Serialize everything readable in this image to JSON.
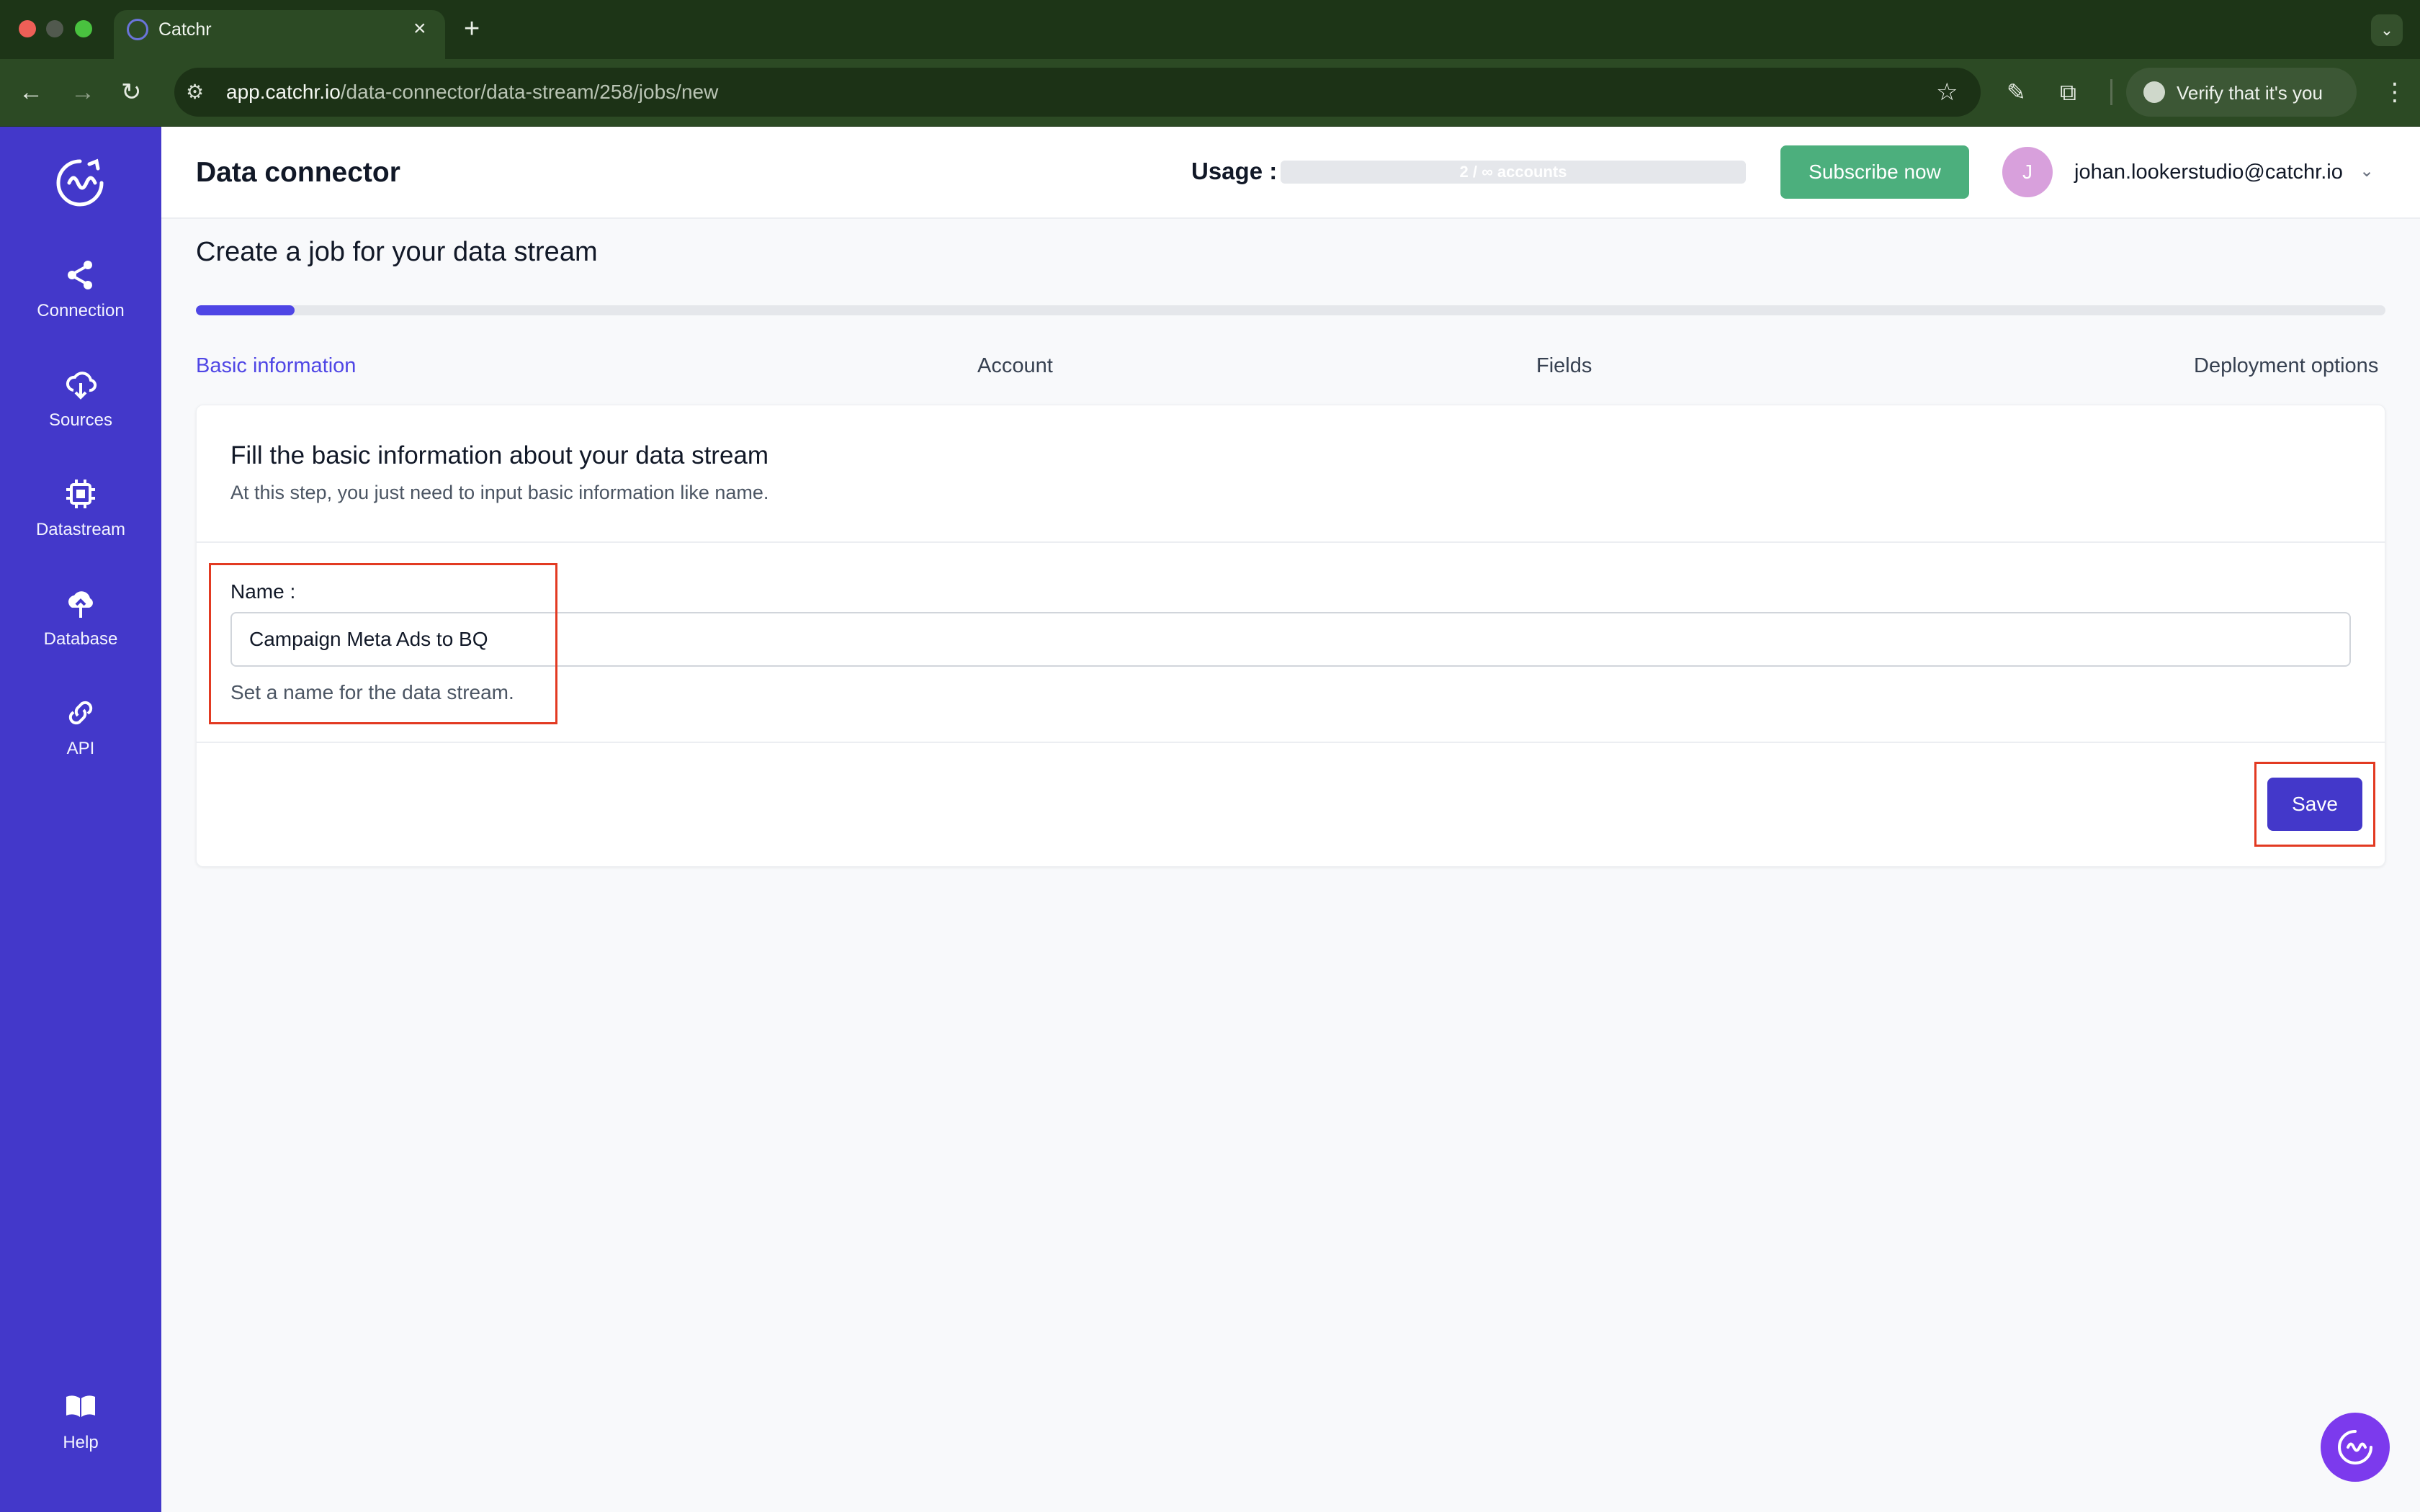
{
  "browser": {
    "tab_title": "Catchr",
    "tab_close": "×",
    "new_tab": "+",
    "tab_menu": "⌄",
    "url_host": "app.catchr.io",
    "url_path": "/data-connector/data-stream/258/jobs/new",
    "verify_label": "Verify that it's you",
    "icons": [
      "back-icon",
      "forward-icon",
      "reload-icon",
      "site-info-icon",
      "star-icon",
      "eyedropper-icon",
      "extensions-icon",
      "menu-icon"
    ]
  },
  "sidebar": {
    "items": [
      {
        "label": "Connection",
        "icon": "share-icon"
      },
      {
        "label": "Sources",
        "icon": "cloud-download-icon"
      },
      {
        "label": "Datastream",
        "icon": "chip-icon"
      },
      {
        "label": "Database",
        "icon": "cloud-upload-icon"
      },
      {
        "label": "API",
        "icon": "link-icon"
      }
    ],
    "help": {
      "label": "Help",
      "icon": "book-icon"
    }
  },
  "header": {
    "title": "Data connector",
    "usage_label": "Usage :",
    "usage_text": "2 / ∞ accounts",
    "subscribe_label": "Subscribe now",
    "avatar_initial": "J",
    "user_email": "johan.lookerstudio@catchr.io",
    "subscribe_color": "#4caf7d"
  },
  "main": {
    "heading": "Create a job for your data stream",
    "progress_fraction": 0.045,
    "steps": [
      {
        "label": "Basic information",
        "active": true
      },
      {
        "label": "Account",
        "active": false
      },
      {
        "label": "Fields",
        "active": false
      },
      {
        "label": "Deployment options",
        "active": false
      }
    ],
    "card": {
      "title": "Fill the basic information about your data stream",
      "subtitle": "At this step, you just need to input basic information like name.",
      "name_label": "Name :",
      "name_value": "Campaign Meta Ads to BQ",
      "name_help": "Set a name for the data stream.",
      "save_label": "Save"
    },
    "accent_color": "#4338ca",
    "highlight_color": "#e23a22"
  }
}
